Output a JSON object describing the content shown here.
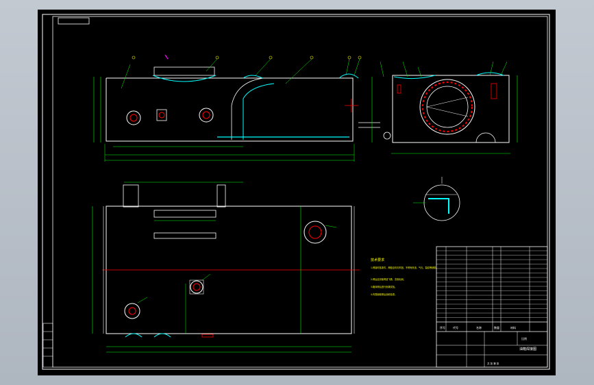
{
  "title_block": {
    "drawing_title": "油箱焊接图",
    "rows": [
      "件号",
      "名称",
      "数量",
      "材料",
      "备注"
    ],
    "header_cells": [
      "序号",
      "代号",
      "名称",
      "数量",
      "材料"
    ],
    "scale_label": "比例",
    "sheet_label": "共 张 第 张"
  },
  "technical_notes": {
    "heading": "技术要求",
    "items": [
      "1.焊接时各零件，焊缝应均匀牢固，不得有夹渣、气孔、裂纹等缺陷。",
      "2.焊后应清除焊渣飞溅，去除毛刺。",
      "3.箱体焊后进行渗漏试验。",
      "4.内表面除锈后涂耐油漆。"
    ]
  },
  "colors": {
    "background": "#000000",
    "outline": "#ffffff",
    "dimension": "#00ff00",
    "hidden_feature": "#00ffff",
    "center_line": "#ff3030",
    "accent": "#ff00ff",
    "notes": "#ffff00"
  }
}
